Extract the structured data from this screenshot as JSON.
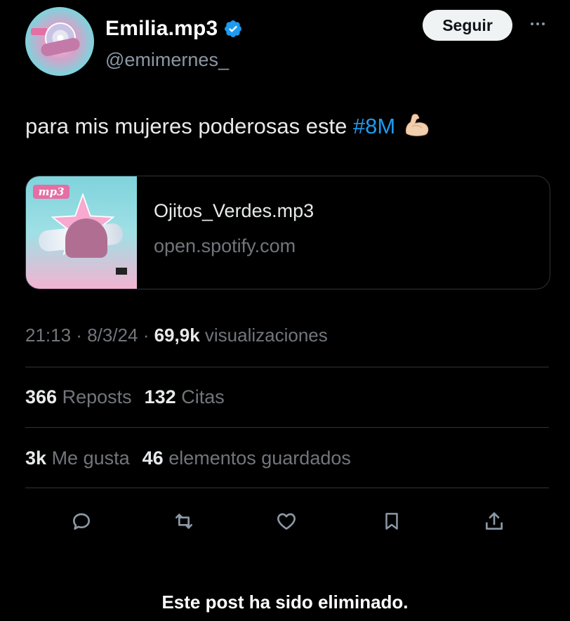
{
  "author": {
    "display_name": "Emilia.mp3",
    "handle": "@emimernes_",
    "verified_icon": "verified-badge-icon",
    "avatar_icon": "avatar-album-art"
  },
  "header": {
    "follow_label": "Seguir",
    "more_icon": "more-options-icon"
  },
  "post": {
    "text_before": "para mis mujeres poderosas este ",
    "hashtag": "#8M",
    "emoji": "💪🏻"
  },
  "link_card": {
    "title": "Ojitos_Verdes.mp3",
    "domain": "open.spotify.com",
    "thumb_label": "mp3"
  },
  "meta": {
    "time": "21:13",
    "sep1": " · ",
    "date": "8/3/24",
    "sep2": " · ",
    "views_count": "69,9k",
    "views_label": " visualizaciones"
  },
  "stats": {
    "reposts_count": "366",
    "reposts_label": "Reposts",
    "quotes_count": "132",
    "quotes_label": "Citas",
    "likes_count": "3k",
    "likes_label": "Me gusta",
    "bookmarks_count": "46",
    "bookmarks_label": "elementos guardados"
  },
  "actions": [
    "reply-icon",
    "repost-icon",
    "like-icon",
    "bookmark-icon",
    "share-icon"
  ],
  "footer": {
    "notice": "Este post ha sido eliminado."
  },
  "colors": {
    "background": "#000000",
    "accent": "#1d9bf0",
    "secondary_text": "#71767b",
    "divider": "#2f3336"
  }
}
